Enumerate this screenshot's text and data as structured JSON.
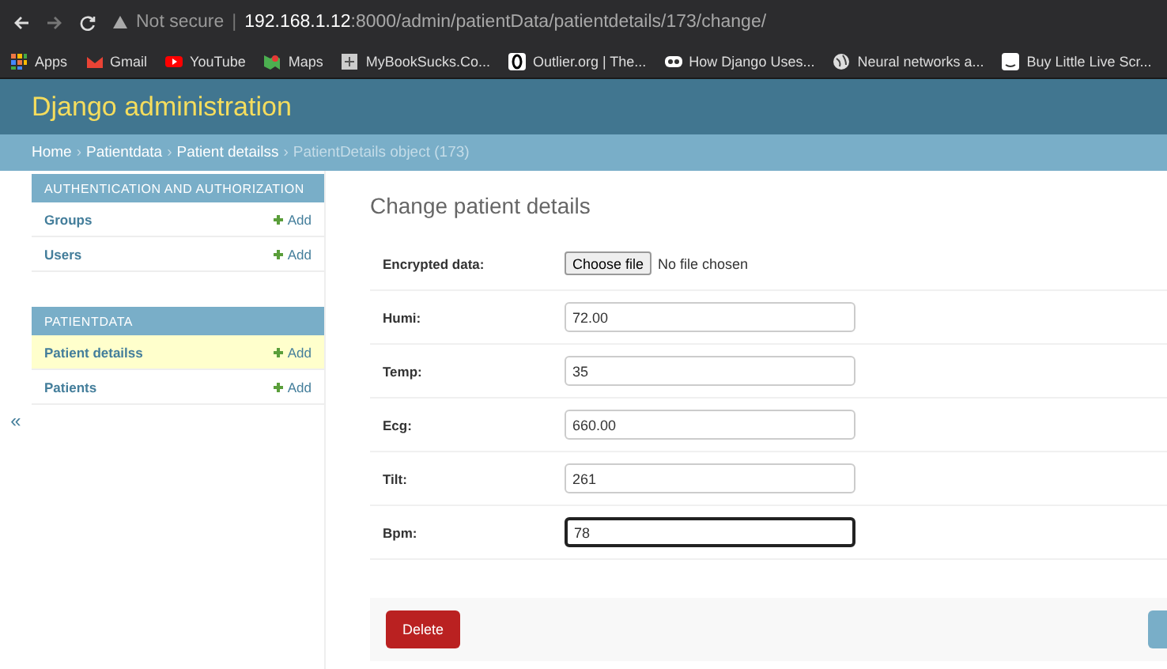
{
  "browser": {
    "security": "Not secure",
    "divider": "|",
    "url_host": "192.168.1.12",
    "url_path": ":8000/admin/patientData/patientdetails/173/change/",
    "bookmarks": [
      {
        "label": "Apps",
        "kind": "grid"
      },
      {
        "label": "Gmail",
        "kind": "mail"
      },
      {
        "label": "YouTube",
        "kind": "play"
      },
      {
        "label": "Maps",
        "kind": "map"
      },
      {
        "label": "MyBookSucks.Co...",
        "kind": "book"
      },
      {
        "label": "Outlier.org | The...",
        "kind": "ring"
      },
      {
        "label": "How Django Uses...",
        "kind": "dots"
      },
      {
        "label": "Neural networks a...",
        "kind": "globe"
      },
      {
        "label": "Buy Little Live Scr...",
        "kind": "store"
      }
    ]
  },
  "header": {
    "title": "Django administration"
  },
  "breadcrumb_separator": "›",
  "breadcrumbs": [
    {
      "label": "Home",
      "current": false
    },
    {
      "label": "Patientdata",
      "current": false
    },
    {
      "label": "Patient detailss",
      "current": false
    },
    {
      "label": "PatientDetails object (173)",
      "current": true
    }
  ],
  "sidebar": {
    "toggle": "«",
    "sections": [
      {
        "caption": "AUTHENTICATION AND AUTHORIZATION",
        "items": [
          {
            "label": "Groups",
            "add": "Add",
            "selected": false
          },
          {
            "label": "Users",
            "add": "Add",
            "selected": false
          }
        ]
      },
      {
        "caption": "PATIENTDATA",
        "items": [
          {
            "label": "Patient detailss",
            "add": "Add",
            "selected": true
          },
          {
            "label": "Patients",
            "add": "Add",
            "selected": false
          }
        ]
      }
    ]
  },
  "content": {
    "title": "Change patient details",
    "fields": [
      {
        "label": "Encrypted data:",
        "kind": "file",
        "button": "Choose file",
        "value": "No file chosen"
      },
      {
        "label": "Humi:",
        "kind": "text",
        "value": "72.00"
      },
      {
        "label": "Temp:",
        "kind": "text",
        "value": "35"
      },
      {
        "label": "Ecg:",
        "kind": "text",
        "value": "660.00"
      },
      {
        "label": "Tilt:",
        "kind": "text",
        "value": "261"
      },
      {
        "label": "Bpm:",
        "kind": "text",
        "value": "78",
        "focused": true
      }
    ],
    "delete_button": "Delete"
  }
}
